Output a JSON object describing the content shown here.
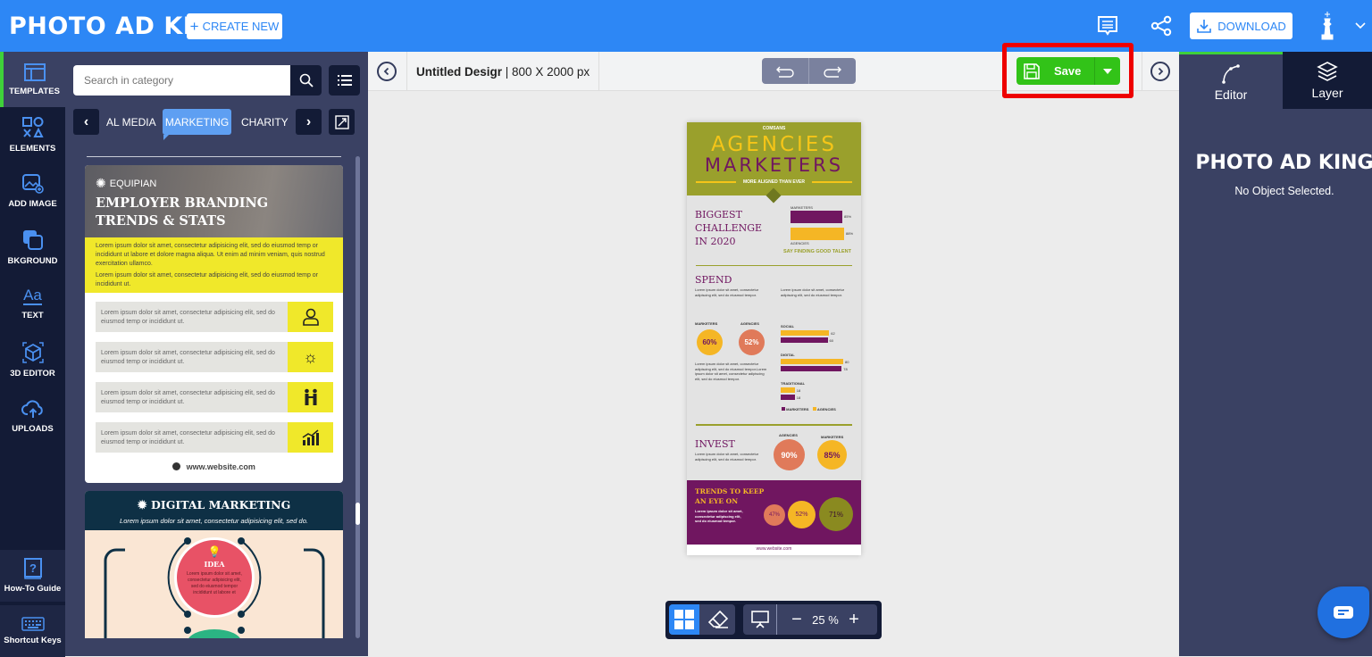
{
  "topbar": {
    "logo": "PHOTO AD KING",
    "create_new": "CREATE NEW",
    "download": "DOWNLOAD",
    "icons": [
      "notes-icon",
      "share-icon",
      "download-icon",
      "king-avatar-icon",
      "chevron-down-icon"
    ]
  },
  "leftnav": {
    "items": [
      {
        "label": "TEMPLATES",
        "icon": "templates-icon",
        "active": true
      },
      {
        "label": "ELEMENTS",
        "icon": "elements-icon"
      },
      {
        "label": "ADD IMAGE",
        "icon": "add-image-icon"
      },
      {
        "label": "BKGROUND",
        "icon": "background-icon"
      },
      {
        "label": "TEXT",
        "icon": "text-icon"
      },
      {
        "label": "3D EDITOR",
        "icon": "cube-icon"
      },
      {
        "label": "UPLOADS",
        "icon": "upload-cloud-icon"
      }
    ],
    "bottom": [
      {
        "label": "How-To Guide",
        "icon": "help-book-icon"
      },
      {
        "label": "Shortcut Keys",
        "icon": "keyboard-icon"
      }
    ]
  },
  "panel": {
    "search_placeholder": "Search in category",
    "categories": [
      "AL MEDIA",
      "MARKETING",
      "CHARITY"
    ],
    "active_category": "MARKETING",
    "template1": {
      "brand": "EQUIPIAN",
      "title_line1": "EMPLOYER BRANDING",
      "title_line2": "TRENDS & STATS",
      "para1": "Lorem ipsum dolor sit amet, consectetur adipisicing elit, sed do eiusmod temp or incididunt ut labore et dolore magna aliqua. Ut enim ad minim veniam, quis nostrud exercitation ullamco.",
      "para2": "Lorem ipsum dolor sit amet, consectetur adipisicing elit, sed do eiusmod temp or incididunt ut.",
      "rows": [
        {
          "text": "Lorem ipsum dolor sit amet, consectetur adipisicing elit, sed do eiusmod temp or incididunt ut.",
          "icon": "person-icon"
        },
        {
          "text": "Lorem ipsum dolor sit amet, consectetur adipisicing elit, sed do eiusmod temp or incididunt ut.",
          "icon": "sun-icon"
        },
        {
          "text": "Lorem ipsum dolor sit amet, consectetur adipisicing elit, sed do eiusmod temp or incididunt ut.",
          "icon": "people-icon"
        },
        {
          "text": "Lorem ipsum dolor sit amet, consectetur adipisicing elit, sed do eiusmod temp or incididunt ut.",
          "icon": "growth-chart-icon"
        }
      ],
      "website": "www.website.com"
    },
    "template2": {
      "title": "DIGITAL MARKETING",
      "subtitle": "Lorem ipsum dolor sit amet, consectetur adipisicing elit, sed do.",
      "circle_title": "IDEA",
      "circle_text": "Lorem ipsum dolor sit amet, consectetur adipisicing elit, sed do eiusmod tempor incididunt ut labore et"
    }
  },
  "canvas_header": {
    "design_name": "Untitled Desigr",
    "size": "| 800 X 2000 px",
    "save": "Save"
  },
  "rightpanel": {
    "tabs": [
      {
        "label": "Editor",
        "icon": "pen-tool-icon"
      },
      {
        "label": "Layer",
        "icon": "layers-icon"
      }
    ],
    "logo": "PHOTO AD KING",
    "message": "No Object Selected."
  },
  "zoom": {
    "level": "25 %"
  },
  "doc": {
    "brand": "COMSANS",
    "title1": "AGENCIES",
    "title2": "MARKETERS",
    "tagline": "MORE ALIGNED THAN EVER",
    "challenge": [
      "BIGGEST",
      "CHALLENGE",
      "IN 2020"
    ],
    "challenge_bars": {
      "marketers_label": "MARKETERS",
      "marketers": "85%",
      "agencies_label": "AGENCIES",
      "agencies": "88%"
    },
    "talent": "SAY FINDING GOOD TALENT",
    "spend_title": "SPEND",
    "lorem": "Lorem ipsum dolor sit amet, consectetur adipiscing elit, sed do eiusmod tempor.",
    "lorem_long": "Lorem ipsum dolor sit amet, consectetur adipiscing elit, sed do eiusmod tempor.Lorem ipsum dolor sit amet, consectetur adipiscing elit, sed do eiusmod tempor.",
    "spend_marketers_label": "MARKETERS",
    "spend_agencies_label": "AGENCIES",
    "spend_marketers": "60%",
    "spend_agencies": "52%",
    "channels": [
      {
        "name": "SOCIAL",
        "agencies": 62,
        "marketers": 60
      },
      {
        "name": "DIGITAL",
        "agencies": 80,
        "marketers": 78
      },
      {
        "name": "TRADITIONAL",
        "agencies": 18,
        "marketers": 18
      }
    ],
    "legend": [
      "MARKETERS",
      "AGENCIES"
    ],
    "invest_title": "INVEST",
    "invest_agencies_label": "AGENCIES",
    "invest_marketers_label": "MARKETERS",
    "invest_agencies": "90%",
    "invest_marketers": "85%",
    "trends_title1": "TRENDS TO KEEP",
    "trends_title2": "AN EYE ON",
    "trends_text": "Lorem ipsum dolor sit amet, consectetur adipiscing elit, sed do eiusmod tempor.",
    "trends": [
      "47%",
      "52%",
      "71%"
    ],
    "website": "www.website.com"
  },
  "colors": {
    "brand_blue": "#2d87f5",
    "save_green": "#32c318",
    "highlight_red": "#ee0000",
    "olive": "#9aa02c",
    "purple": "#701660",
    "gold": "#f5b625"
  }
}
